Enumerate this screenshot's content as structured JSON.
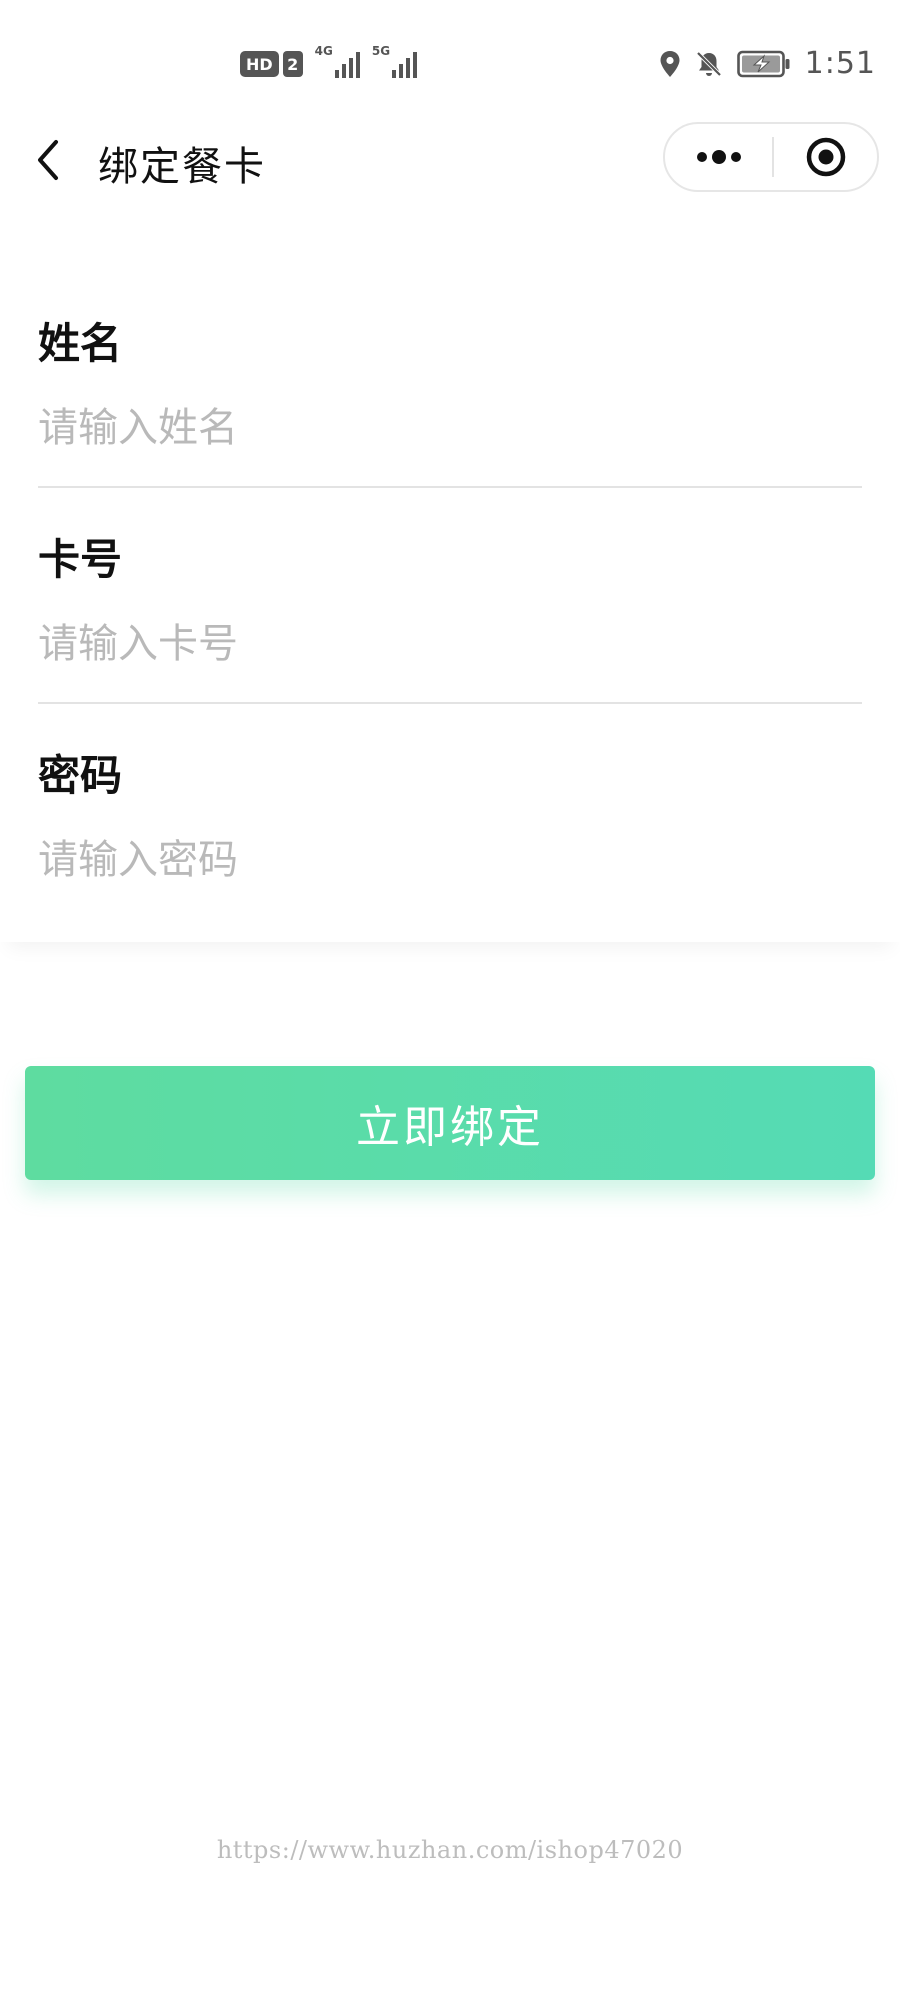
{
  "status_bar": {
    "hd_label": "HD",
    "sim_label": "2",
    "network_1": "4G",
    "network_2": "5G",
    "time": "1:51",
    "icons": [
      "location-icon",
      "bell-muted-icon",
      "battery-charging-icon"
    ],
    "icon_color": "#555555"
  },
  "nav": {
    "title": "绑定餐卡",
    "icons": [
      "back-icon",
      "more-icon",
      "close-miniprogram-icon"
    ]
  },
  "form": {
    "fields": [
      {
        "label": "姓名",
        "placeholder": "请输入姓名"
      },
      {
        "label": "卡号",
        "placeholder": "请输入卡号"
      },
      {
        "label": "密码",
        "placeholder": "请输入密码"
      }
    ],
    "placeholder_color": "#b9b9b9",
    "divider_color": "#e3e3e3"
  },
  "submit": {
    "label": "立即绑定",
    "gradient_start": "#5edca0",
    "gradient_end": "#55dbb5",
    "text_color": "#ffffff"
  },
  "watermark": "https://www.huzhan.com/ishop47020"
}
